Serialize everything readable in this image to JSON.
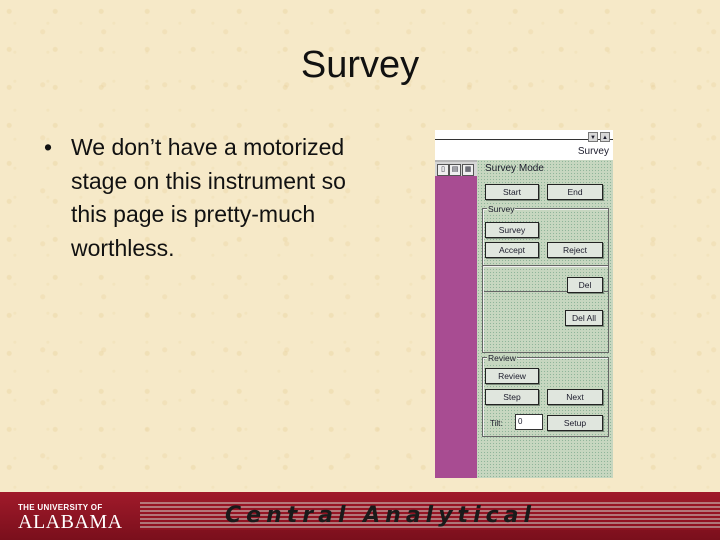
{
  "slide": {
    "title": "Survey",
    "bullet_marker": "•",
    "bullet_text": "We don’t have a motorized stage on this instrument so this page is pretty-much worthless."
  },
  "panel": {
    "window_title": "Survey",
    "mode_title": "Survey Mode",
    "buttons": {
      "start": "Start",
      "end": "End",
      "survey": "Survey",
      "accept": "Accept",
      "reject": "Reject",
      "del": "Del",
      "del_all": "Del All",
      "review": "Review",
      "step": "Step",
      "next": "Next",
      "setup": "Setup"
    },
    "groups": {
      "survey": "Survey",
      "review": "Review"
    },
    "tilt_label": "Tilt:",
    "tilt_value": "0",
    "scroll_up_icon": "up-arrow",
    "scroll_down_icon": "down-arrow",
    "colors": {
      "side_strip": "#a84c92",
      "panel_bg": "#c7d7c0"
    }
  },
  "footer": {
    "logo_top": "THE UNIVERSITY OF",
    "logo_main": "ALABAMA",
    "text": "Central Analytical"
  }
}
